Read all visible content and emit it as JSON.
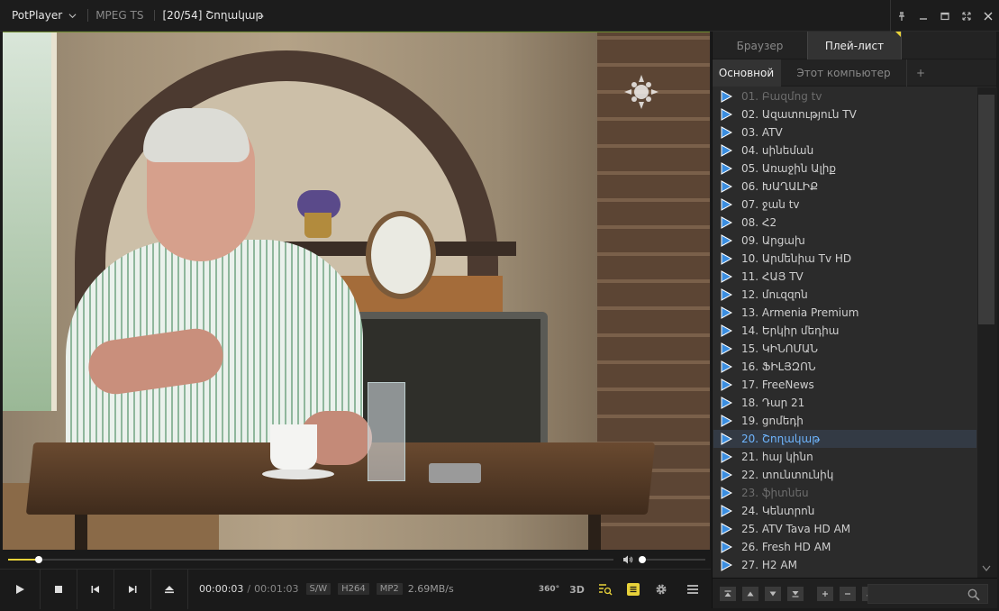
{
  "titlebar": {
    "app_name": "PotPlayer",
    "codec": "MPEG TS",
    "title": "[20/54] Շողակաթ"
  },
  "panel": {
    "tabs": [
      {
        "label": "Браузер"
      },
      {
        "label": "Плей-лист"
      }
    ],
    "subtabs": [
      {
        "label": "Основной"
      },
      {
        "label": "Этот компьютер"
      },
      {
        "label": "+"
      }
    ],
    "playlist": [
      {
        "label": "01. Բազմոց tv",
        "state": "dim"
      },
      {
        "label": "02. Ազատություն TV",
        "state": ""
      },
      {
        "label": "03. ATV",
        "state": ""
      },
      {
        "label": "04. սինեման",
        "state": ""
      },
      {
        "label": "05. Առաջին Ալիք",
        "state": ""
      },
      {
        "label": "06. ԽԱՂԱԼԻՔ",
        "state": ""
      },
      {
        "label": "07. ջան tv",
        "state": ""
      },
      {
        "label": "08. Հ2",
        "state": ""
      },
      {
        "label": "09. Արցախ",
        "state": ""
      },
      {
        "label": "10. Արմենիա Tv HD",
        "state": ""
      },
      {
        "label": "11. ՀԱՅ TV",
        "state": ""
      },
      {
        "label": "12. մուզզոն",
        "state": ""
      },
      {
        "label": "13. Armenia Premium",
        "state": ""
      },
      {
        "label": "14. Երկիր մեդիա",
        "state": ""
      },
      {
        "label": "15. ԿԻՆՈՄԱՆ",
        "state": ""
      },
      {
        "label": "16. ՖԻԼՅԶՈՆ",
        "state": ""
      },
      {
        "label": "17. FreeNews",
        "state": ""
      },
      {
        "label": "18. Դար 21",
        "state": ""
      },
      {
        "label": "19. ցոմեդի",
        "state": ""
      },
      {
        "label": "20. Շողակաթ",
        "state": "current"
      },
      {
        "label": "21. հայ կինո",
        "state": ""
      },
      {
        "label": "22. տունտունիկ",
        "state": ""
      },
      {
        "label": "23. ֆիտնես",
        "state": "dim"
      },
      {
        "label": "24. Կենտրոն",
        "state": ""
      },
      {
        "label": "25. ATV Tava HD AM",
        "state": ""
      },
      {
        "label": "26. Fresh HD AM",
        "state": ""
      },
      {
        "label": "27. H2 AM",
        "state": ""
      }
    ]
  },
  "controls": {
    "time_current": "00:00:03",
    "time_separator": "/",
    "time_total": "00:01:03",
    "badges": [
      "S/W",
      "H264",
      "MP2"
    ],
    "rate": "2.69MB/s",
    "label_360": "360°",
    "label_3d": "3D",
    "seek_fraction": 0.05,
    "volume_fraction": 0.0
  },
  "colors": {
    "accent": "#e8d23a",
    "current_item": "#6fb6ff",
    "triangle": "#3b8ee0"
  }
}
